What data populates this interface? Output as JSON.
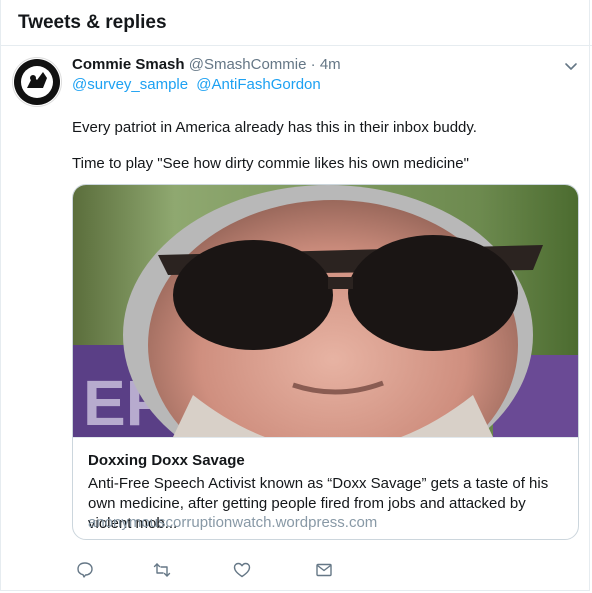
{
  "header": {
    "title": "Tweets & replies"
  },
  "tweet": {
    "author_name": "Commie Smash",
    "author_handle": "@SmashCommie",
    "separator": "·",
    "time": "4m",
    "mentions": [
      "@survey_sample",
      "@AntiFashGordon"
    ],
    "text_lines": [
      "Every patriot in America already has this in their inbox buddy.",
      "Time to play \"See how dirty commie likes his own medicine\""
    ],
    "card": {
      "title": "Doxxing Doxx Savage",
      "description": "Anti-Free Speech Activist known as “Doxx Savage” gets a taste of his own medicine, after getting people fired from jobs and attacked by violent mob...",
      "domain": "anonymouscorruptionwatch.wordpress.com"
    },
    "actions": [
      "reply-icon",
      "retweet-icon",
      "like-icon",
      "message-icon"
    ],
    "icons": {
      "caret": "chevron-down-icon"
    }
  },
  "colors": {
    "link": "#1da1f2",
    "secondary": "#657786",
    "border": "#e6ecf0",
    "domain": "#8899a6"
  }
}
